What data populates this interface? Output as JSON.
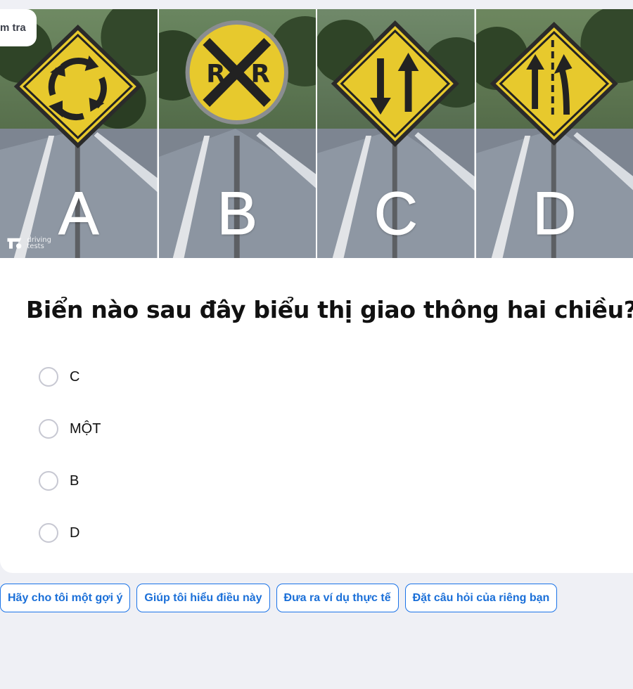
{
  "top_chip": {
    "label": "m tra"
  },
  "image": {
    "panels": [
      {
        "letter": "A",
        "sign": "roundabout-sign-icon"
      },
      {
        "letter": "B",
        "sign": "railroad-crossing-sign-icon"
      },
      {
        "letter": "C",
        "sign": "two-way-traffic-sign-icon"
      },
      {
        "letter": "D",
        "sign": "merge-lane-sign-icon"
      }
    ],
    "watermark": "driving tests"
  },
  "question": {
    "text": "Biển nào sau đây biểu thị giao thông hai chiều?"
  },
  "options": [
    {
      "label": "C"
    },
    {
      "label": "MỘT"
    },
    {
      "label": "B"
    },
    {
      "label": "D"
    }
  ],
  "suggestions": [
    {
      "label": "Hãy cho tôi một gợi ý"
    },
    {
      "label": "Giúp tôi hiểu điều này"
    },
    {
      "label": "Đưa ra ví dụ thực tế"
    },
    {
      "label": "Đặt câu hỏi của riêng bạn"
    }
  ],
  "colors": {
    "page_bg": "#eff0f5",
    "accent": "#1a73e8",
    "sign_yellow": "#e8cc2a"
  }
}
